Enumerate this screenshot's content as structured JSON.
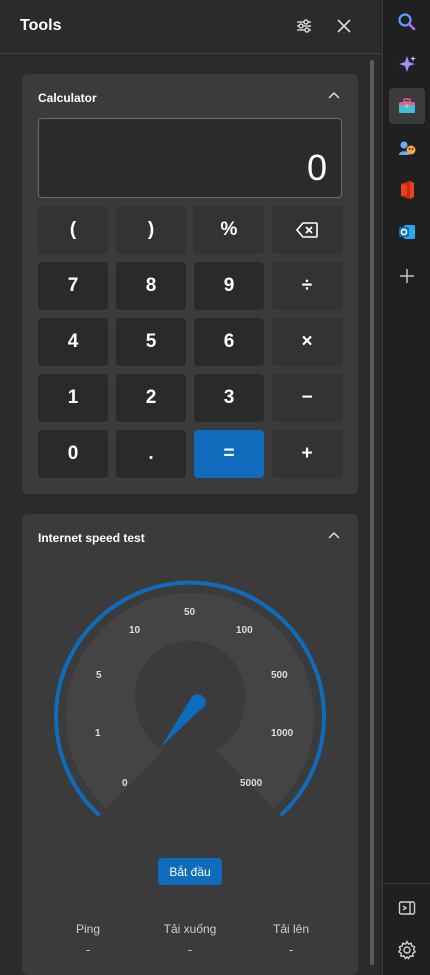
{
  "panel": {
    "title": "Tools",
    "header_icons": [
      "sliders-icon",
      "close-icon"
    ]
  },
  "calculator": {
    "title": "Calculator",
    "display": "0",
    "keys": [
      [
        "(",
        ")",
        "%",
        "⌫"
      ],
      [
        "7",
        "8",
        "9",
        "÷"
      ],
      [
        "4",
        "5",
        "6",
        "×"
      ],
      [
        "1",
        "2",
        "3",
        "−"
      ],
      [
        "0",
        ".",
        "=",
        "+"
      ]
    ]
  },
  "speed_test": {
    "title": "Internet speed test",
    "scale_labels": [
      "0",
      "1",
      "5",
      "10",
      "50",
      "100",
      "500",
      "1000",
      "5000"
    ],
    "start_label": "Bắt đầu",
    "stats": [
      {
        "label": "Ping",
        "value": "-"
      },
      {
        "label": "Tải xuống",
        "value": "-"
      },
      {
        "label": "Tải lên",
        "value": "-"
      }
    ]
  },
  "rail": {
    "items": [
      "search-icon",
      "copilot-icon",
      "tools-icon",
      "games-icon",
      "office-icon",
      "outlook-icon",
      "add-icon"
    ],
    "bottom": [
      "hide-sidebar-icon",
      "settings-icon"
    ]
  },
  "colors": {
    "accent": "#0f6cbd",
    "panel_bg": "#2b2b2b",
    "card_bg": "#3b3b3b"
  }
}
